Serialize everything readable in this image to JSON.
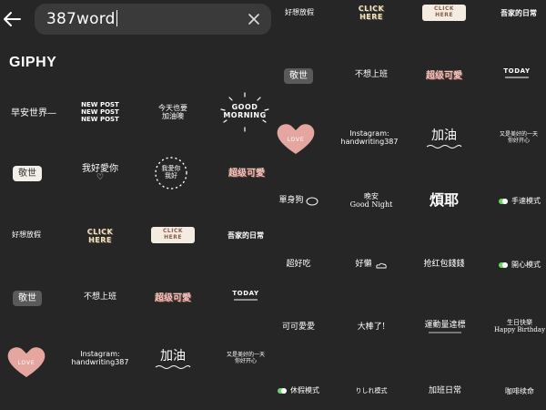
{
  "search": {
    "query": "387word",
    "back_icon": "back-arrow-icon",
    "clear_icon": "close-icon"
  },
  "provider": {
    "label": "GIPHY"
  },
  "left_stickers": {
    "r1": [
      "早安世界—",
      "NEW POST\nNEW POST\nNEW POST",
      "今天也要\n加油噢",
      "GOOD\nMORNING"
    ],
    "r2": [
      "敬世",
      "我好愛你",
      "我愛你\n我好",
      "超级可愛"
    ],
    "r3": [
      "好想放假",
      "CLICK\nHERE",
      "CLICK HERE",
      "吾家的日常"
    ],
    "r4": [
      "敬世",
      "不想上班",
      "超级可愛",
      "TODAY"
    ],
    "r5": [
      "LOVE",
      "Instagram:\nhandwriting387",
      "加油",
      "又是美好的一天\n你好开心"
    ]
  },
  "right_stickers": {
    "r0": [
      "好想放假",
      "CLICK\nHERE",
      "CLICK HERE",
      "吾家的日常"
    ],
    "r1": [
      "敬世",
      "不想上班",
      "超级可愛",
      "TODAY"
    ],
    "r2": [
      "LOVE",
      "Instagram:\nhandwriting387",
      "加油",
      "又是美好的一天\n你好开心"
    ],
    "r3": [
      "單身狗",
      "晚安\nGood Night",
      "煩耶",
      "手速模式"
    ],
    "r4": [
      "超好吃",
      "好懶",
      "抢红包錢錢",
      "開心模式"
    ],
    "r5": [
      "可可愛愛",
      "大棒了!",
      "運動量達標",
      "生日快樂\nHappy Birthday"
    ],
    "r6": [
      "休假模式",
      "りしれ模式",
      "加班日常",
      "咖啡续命"
    ]
  },
  "colors": {
    "background": "#262626",
    "search_field": "#3a3a3a",
    "heart_pink": "#e5a6a0",
    "toggle_green": "#6fd36a"
  }
}
